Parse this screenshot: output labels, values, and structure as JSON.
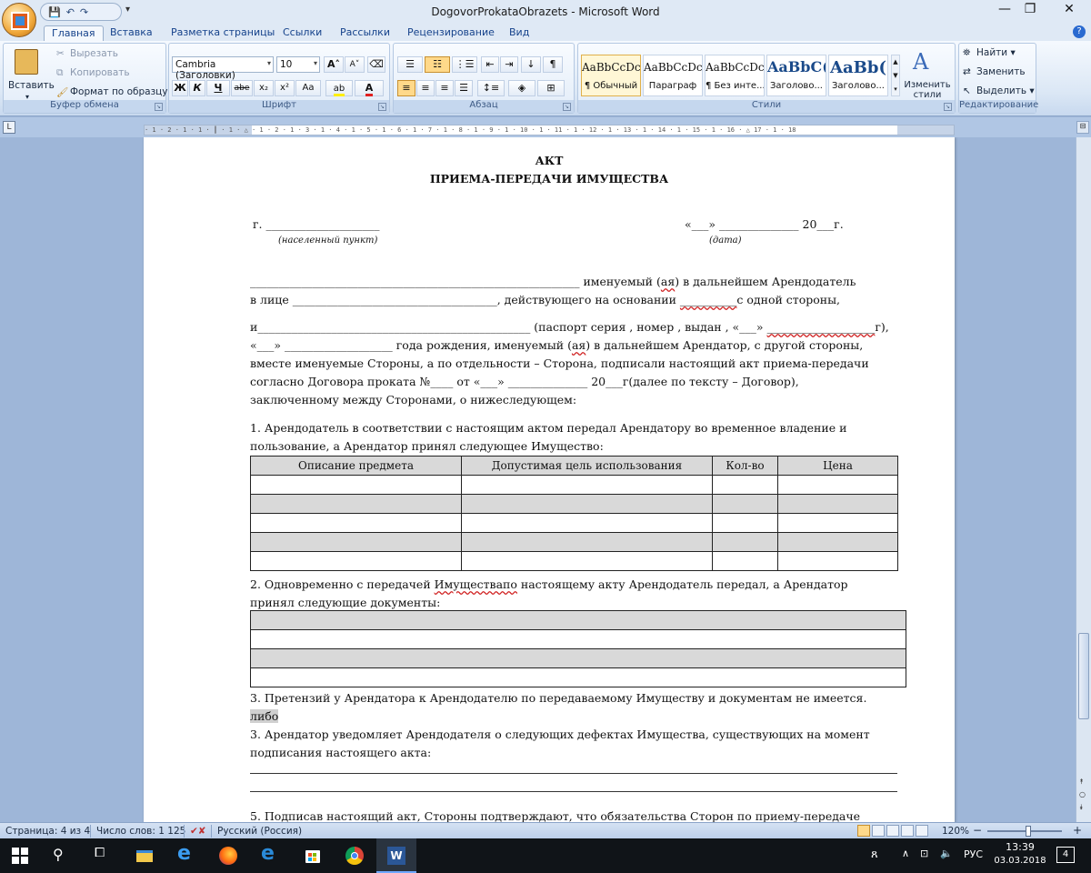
{
  "titlebar": {
    "title": "DogovorProkataObrazets - Microsoft Word",
    "qat": [
      "💾",
      "↶",
      "↷"
    ],
    "minimize": "—",
    "restore": "❐",
    "close": "✕"
  },
  "tabs": [
    {
      "label": "Главная",
      "active": true
    },
    {
      "label": "Вставка"
    },
    {
      "label": "Разметка страницы"
    },
    {
      "label": "Ссылки"
    },
    {
      "label": "Рассылки"
    },
    {
      "label": "Рецензирование"
    },
    {
      "label": "Вид"
    }
  ],
  "ribbon": {
    "clipboard": {
      "label": "Буфер обмена",
      "paste": "Вставить",
      "cut": "Вырезать",
      "copy": "Копировать",
      "format_painter": "Формат по образцу"
    },
    "font": {
      "label": "Шрифт",
      "font_name": "Cambria (Заголовки)",
      "font_size": "10",
      "bold": "Ж",
      "italic": "К",
      "underline": "Ч",
      "strike": "abe",
      "subscript": "x₂",
      "superscript": "x²",
      "case": "Aa",
      "grow": "A",
      "shrink": "A"
    },
    "paragraph": {
      "label": "Абзац"
    },
    "styles": {
      "label": "Стили",
      "items": [
        {
          "sample": "AaBbCcDc",
          "name": "¶ Обычный",
          "active": true
        },
        {
          "sample": "AaBbCcDc",
          "name": "Параграф"
        },
        {
          "sample": "AaBbCcDc",
          "name": "¶ Без инте..."
        },
        {
          "sample": "AaBbC(",
          "name": "Заголово..."
        },
        {
          "sample": "AaBb(",
          "name": "Заголово..."
        }
      ],
      "change_styles": "Изменить стили"
    },
    "editing": {
      "label": "Редактирование",
      "find": "Найти",
      "replace": "Заменить",
      "select": "Выделить"
    }
  },
  "ruler": {
    "ticks": "· 1 · 2 · 1 · 1 · ┃ · 1 · △ · 1 · 2 · 1 · 3 · 1 · 4 · 1 · 5 · 1 · 6 · 1 · 7 · 1 · 8 · 1 · 9 · 1 · 10 · 1 · 11 · 1 · 12 · 1 · 13 · 1 · 14 · 1 · 15 · 1 · 16 · △ 17 · 1 · 18"
  },
  "document": {
    "heading1": "АКТ",
    "heading2": "ПРИЕМА-ПЕРЕДАЧИ ИМУЩЕСТВА",
    "city_line": "г. ____________________",
    "city_caption": "(населенный пункт)",
    "date_line": "«___» ______________ 20___г.",
    "date_caption": "(дата)",
    "p1_a": "__________________________________________________________ именуемый (",
    "p1_aya": "ая",
    "p1_b": ") в дальнейшем Арендодатель",
    "p2_a": "в лице ____________________________________, действующего на основании ",
    "p2_blank": "__________",
    "p2_b": "с одной стороны,",
    "p3_a": "и________________________________________________ (паспорт серия , номер , выдан , «___» ",
    "p3_blank": "___________________",
    "p3_b": "г),",
    "p4_a": "«___» ___________________ года рождения, именуемый (",
    "p4_aya": "ая",
    "p4_b": ") в дальнейшем Арендатор, с другой стороны,",
    "p5": "вместе именуемые Стороны, а по отдельности – Сторона, подписали настоящий акт приема-передачи",
    "p6": "согласно Договора проката №____  от «___» ______________ 20___г(далее по тексту – Договор),",
    "p7": "заключенному между Сторонами, о нижеследующем:",
    "s1_a": "1. Арендодатель в соответствии  с настоящим актом передал Арендатору во временное владение и",
    "s1_b": "пользование, а Арендатор принял следующее Имущество:",
    "table1_headers": [
      "Описание предмета",
      "Допустимая цель использования",
      "Кол-во",
      "Цена"
    ],
    "s2_a_pre": "2. Одновременно с передачей ",
    "s2_a_err": "Имуществапо",
    "s2_a_post": " настоящему акту Арендодатель передал, а Арендатор",
    "s2_b": "принял следующие документы:",
    "s3_a": "3. Претензий у Арендатора к Арендодателю по передаваемому Имуществу и документам не имеется.",
    "s3_or": "либо",
    "s3_b": "3. Арендатор уведомляет Арендодателя о следующих дефектах Имущества, существующих на момент",
    "s3_c": "подписания настоящего акта:",
    "s5": " 5. Подписав настоящий акт, Стороны подтверждают, что обязательства Сторон по приему-передаче"
  },
  "statusbar": {
    "page": "Страница: 4 из 4",
    "words": "Число слов: 1 125",
    "language": "Русский (Россия)",
    "zoom": "120%",
    "zoom_minus": "−",
    "zoom_plus": "+"
  },
  "taskbar": {
    "lang": "РУС",
    "time": "13:39",
    "date": "03.03.2018",
    "notif": "4"
  }
}
